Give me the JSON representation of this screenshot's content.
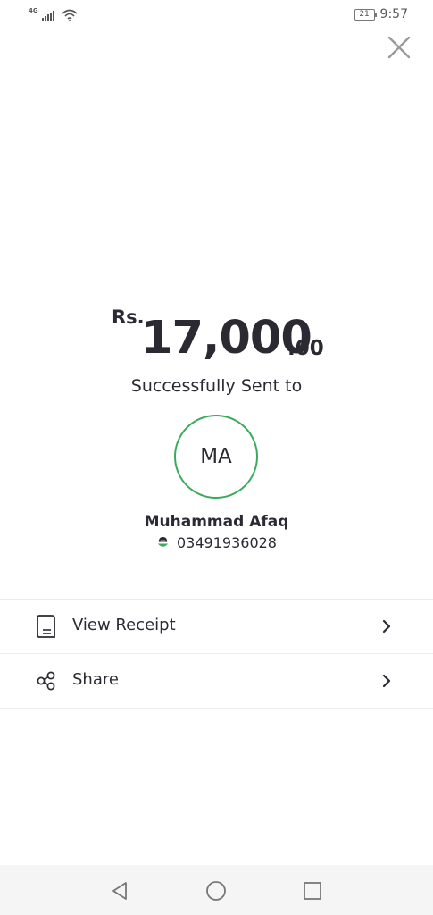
{
  "status_bar": {
    "network": "4G",
    "battery": "21",
    "time": "9:57"
  },
  "payment": {
    "currency": "Rs.",
    "amount_whole": "17,000",
    "amount_decimal": ".00",
    "status_text": "Successfully Sent to"
  },
  "recipient": {
    "initials": "MA",
    "name": "Muhammad Afaq",
    "phone": "03491936028",
    "wallet_icon": "easypaisa-logo-icon"
  },
  "actions": [
    {
      "label": "View Receipt",
      "icon": "receipt-icon"
    },
    {
      "label": "Share",
      "icon": "share-icon"
    }
  ],
  "colors": {
    "accent_green": "#3aaa5c",
    "text": "#2b2a33"
  }
}
